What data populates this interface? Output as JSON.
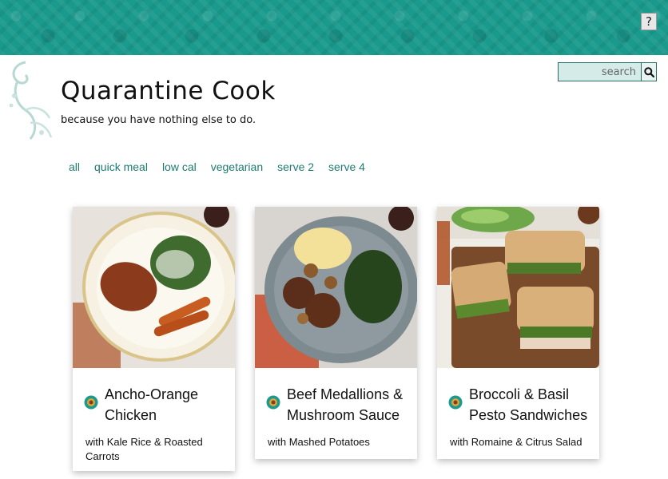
{
  "header": {
    "help_label": "?",
    "accent_color": "#1a9a8d"
  },
  "search": {
    "placeholder": "search",
    "icon": "search-icon"
  },
  "site": {
    "title": "Quarantine Cook",
    "tagline": "because you have nothing else to do."
  },
  "filters": [
    "all",
    "quick meal",
    "low cal",
    "vegetarian",
    "serve 2",
    "serve 4"
  ],
  "recipes": [
    {
      "title": "Ancho-Orange Chicken",
      "subtitle": "with Kale Rice & Roasted Carrots",
      "image": "plate-with-chicken-kale-rice-carrots"
    },
    {
      "title": "Beef Medallions & Mushroom Sauce",
      "subtitle": "with Mashed Potatoes",
      "image": "plate-with-beef-mushrooms-potatoes-kale"
    },
    {
      "title": "Broccoli & Basil Pesto Sandwiches",
      "subtitle": "with Romaine & Citrus Salad",
      "image": "pesto-sandwiches-on-board-with-salad"
    }
  ]
}
